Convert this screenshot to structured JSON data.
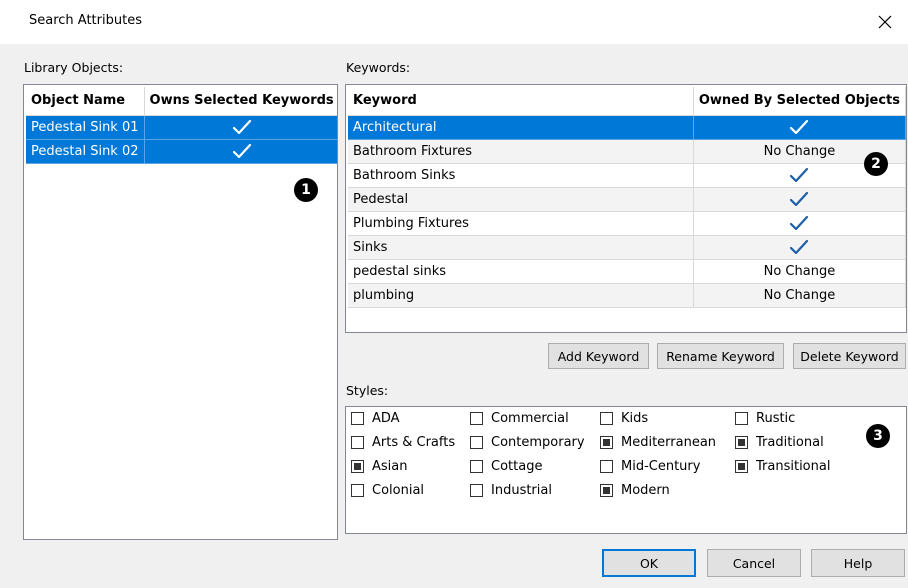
{
  "window": {
    "title": "Search Attributes"
  },
  "library": {
    "label": "Library Objects:",
    "col_name": "Object Name",
    "col_owns": "Owns Selected Keywords",
    "rows": [
      {
        "name": "Pedestal Sink 01",
        "owns": "check",
        "selected": true
      },
      {
        "name": "Pedestal Sink 02",
        "owns": "check",
        "selected": true
      }
    ]
  },
  "keywords": {
    "label": "Keywords:",
    "col_keyword": "Keyword",
    "col_owned": "Owned By Selected Objects",
    "rows": [
      {
        "keyword": "Architectural",
        "owned": "check",
        "selected": true
      },
      {
        "keyword": "Bathroom Fixtures",
        "owned": "No Change"
      },
      {
        "keyword": "Bathroom Sinks",
        "owned": "check"
      },
      {
        "keyword": "Pedestal",
        "owned": "check"
      },
      {
        "keyword": "Plumbing Fixtures",
        "owned": "check"
      },
      {
        "keyword": "Sinks",
        "owned": "check"
      },
      {
        "keyword": "pedestal sinks",
        "owned": "No Change"
      },
      {
        "keyword": "plumbing",
        "owned": "No Change"
      }
    ],
    "buttons": {
      "add": "Add Keyword",
      "rename": "Rename Keyword",
      "delete": "Delete Keyword"
    }
  },
  "styles": {
    "label": "Styles:",
    "columns": [
      [
        {
          "label": "ADA",
          "checked": false
        },
        {
          "label": "Arts & Crafts",
          "checked": false
        },
        {
          "label": "Asian",
          "checked": true
        },
        {
          "label": "Colonial",
          "checked": false
        }
      ],
      [
        {
          "label": "Commercial",
          "checked": false
        },
        {
          "label": "Contemporary",
          "checked": false
        },
        {
          "label": "Cottage",
          "checked": false
        },
        {
          "label": "Industrial",
          "checked": false
        }
      ],
      [
        {
          "label": "Kids",
          "checked": false
        },
        {
          "label": "Mediterranean",
          "checked": true
        },
        {
          "label": "Mid-Century",
          "checked": false
        },
        {
          "label": "Modern",
          "checked": true
        }
      ],
      [
        {
          "label": "Rustic",
          "checked": false
        },
        {
          "label": "Traditional",
          "checked": true
        },
        {
          "label": "Transitional",
          "checked": true
        }
      ]
    ]
  },
  "callouts": {
    "one": "1",
    "two": "2",
    "three": "3"
  },
  "footer": {
    "ok": "OK",
    "cancel": "Cancel",
    "help": "Help"
  },
  "colors": {
    "selection": "#0078d7",
    "check_dark": "#1a5fa8",
    "focus_border": "#0078d7"
  }
}
